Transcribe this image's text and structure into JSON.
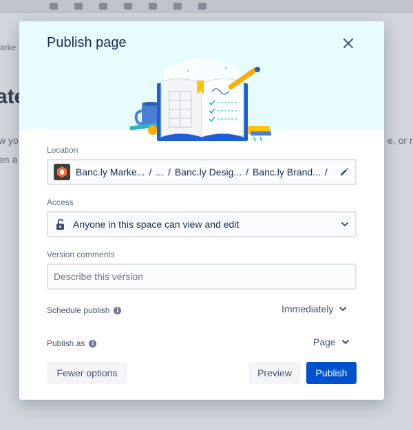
{
  "background": {
    "breadcrumb": "arke",
    "title": "ate",
    "text_line1": "w yo",
    "text_line2": "en a",
    "text_right": "e, or ro"
  },
  "modal": {
    "title": "Publish page",
    "location": {
      "label": "Location",
      "crumbs": [
        "Banc.ly Marke...",
        "/",
        "...",
        "/",
        "Banc.ly Desig...",
        "/",
        "Banc.ly Brand...",
        "/"
      ]
    },
    "access": {
      "label": "Access",
      "value": "Anyone in this space can view and edit"
    },
    "version": {
      "label": "Version comments",
      "placeholder": "Describe this version"
    },
    "schedule": {
      "label": "Schedule publish",
      "value": "Immediately"
    },
    "publish_as": {
      "label": "Publish as",
      "value": "Page"
    },
    "buttons": {
      "fewer_options": "Fewer options",
      "preview": "Preview",
      "publish": "Publish"
    },
    "icons": {
      "close": "close-icon",
      "edit": "pencil-icon",
      "lock": "unlock-icon",
      "chevron": "chevron-down-icon",
      "info": "info-icon",
      "space": "space-avatar-icon"
    },
    "colors": {
      "primary": "#0052cc",
      "hero_bg": "#e6fcff",
      "subtle_btn": "#f4f5f7"
    }
  }
}
